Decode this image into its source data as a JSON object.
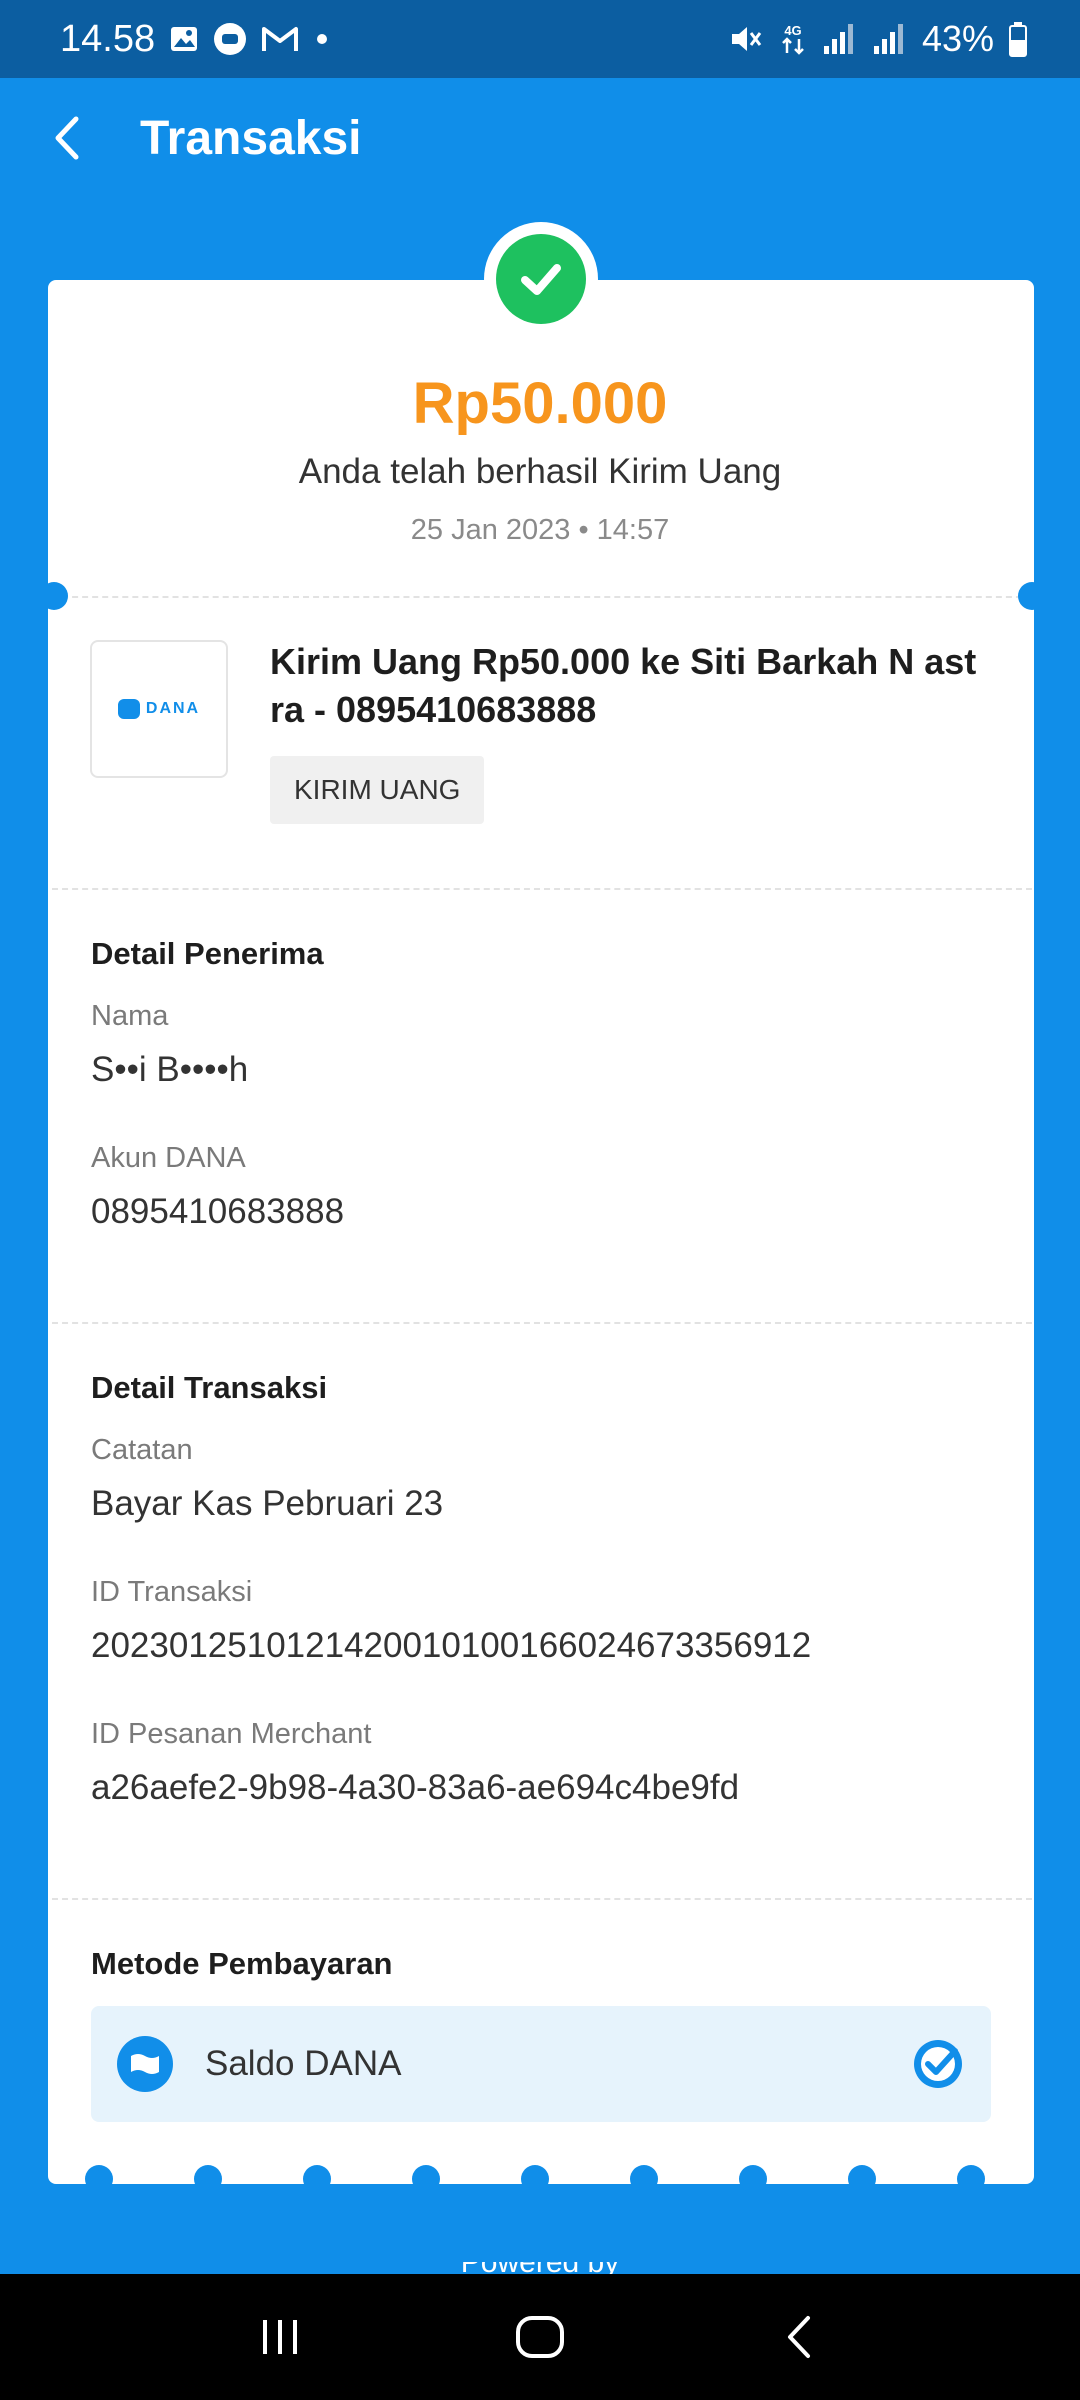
{
  "status_bar": {
    "time": "14.58",
    "battery": "43%",
    "network": "4G",
    "icons": [
      "gallery-icon",
      "chat-icon",
      "gmail-icon",
      "dot-icon",
      "mute-icon",
      "data-4g-icon",
      "signal-icon",
      "signal-icon",
      "battery-icon"
    ]
  },
  "header": {
    "title": "Transaksi",
    "back_icon": "chevron-left-icon"
  },
  "summary": {
    "amount": "Rp50.000",
    "headline": "Anda telah berhasil Kirim Uang",
    "datetime": "25 Jan 2023 • 14:57",
    "status_icon": "success-check-icon"
  },
  "transaction": {
    "merchant_logo_text": "DANA",
    "description": "Kirim Uang Rp50.000 ke Siti Barkah N astra - 0895410683888",
    "tag": "KIRIM UANG"
  },
  "recipient": {
    "title": "Detail Penerima",
    "name_label": "Nama",
    "name_value": "S••i B••••h",
    "account_label": "Akun DANA",
    "account_value": "0895410683888"
  },
  "details": {
    "title": "Detail Transaksi",
    "note_label": "Catatan",
    "note_value": "Bayar Kas Pebruari 23",
    "txn_id_label": "ID Transaksi",
    "txn_id_value": "2023012510121420010100166024673356912",
    "order_id_label": "ID Pesanan Merchant",
    "order_id_value": "a26aefe2-9b98-4a30-83a6-ae694c4be9fd"
  },
  "payment": {
    "title": "Metode Pembayaran",
    "method": "Saldo DANA",
    "selected": true
  },
  "footer": {
    "partial_text": "Powered by"
  },
  "nav": {
    "recents_icon": "recents-icon",
    "home_icon": "home-icon",
    "back_icon": "back-icon"
  },
  "colors": {
    "background": "#108ee9",
    "status_bar": "#0c5ea1",
    "amount": "#f7951d",
    "success": "#1ec15f",
    "payment_box": "#e6f3fc"
  }
}
